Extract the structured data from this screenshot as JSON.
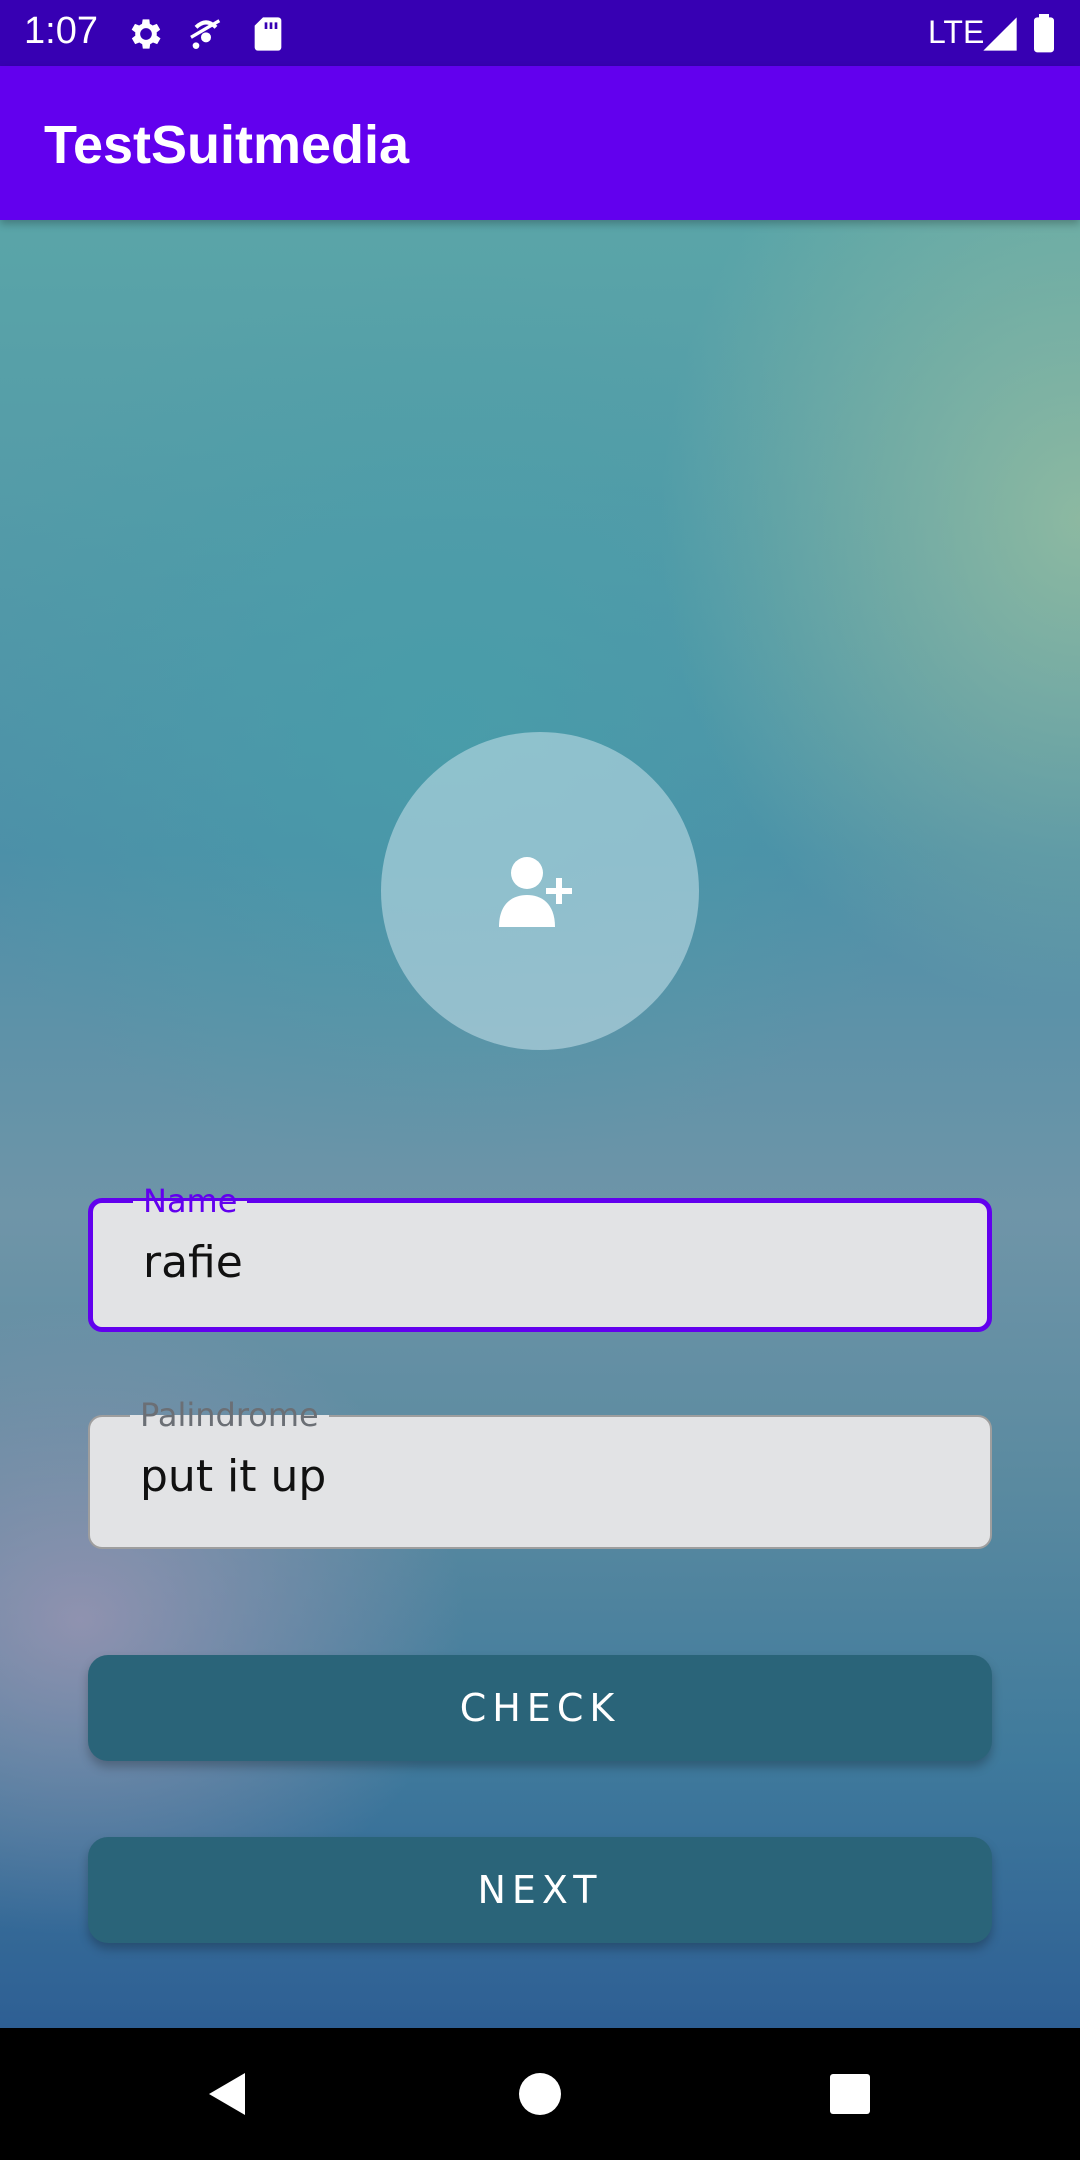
{
  "status_bar": {
    "time": "1:07",
    "network": "LTE",
    "icons": [
      "gear-icon",
      "signal-off-icon",
      "sd-card-icon",
      "cell-signal-icon",
      "battery-icon"
    ]
  },
  "app_bar": {
    "title": "TestSuitmedia"
  },
  "main": {
    "avatar_icon": "add-person-icon",
    "name_field": {
      "label": "Name",
      "value": "rafie"
    },
    "palindrome_field": {
      "label": "Palindrome",
      "value": "put it up"
    },
    "check_button": "CHECK",
    "next_button": "NEXT"
  },
  "nav_bar": {
    "icons": [
      "back-icon",
      "home-icon",
      "recents-icon"
    ]
  },
  "colors": {
    "status_bar": "#3700b3",
    "app_bar": "#6200ee",
    "button": "#2a6479",
    "field_bg": "#e2e3e5"
  }
}
